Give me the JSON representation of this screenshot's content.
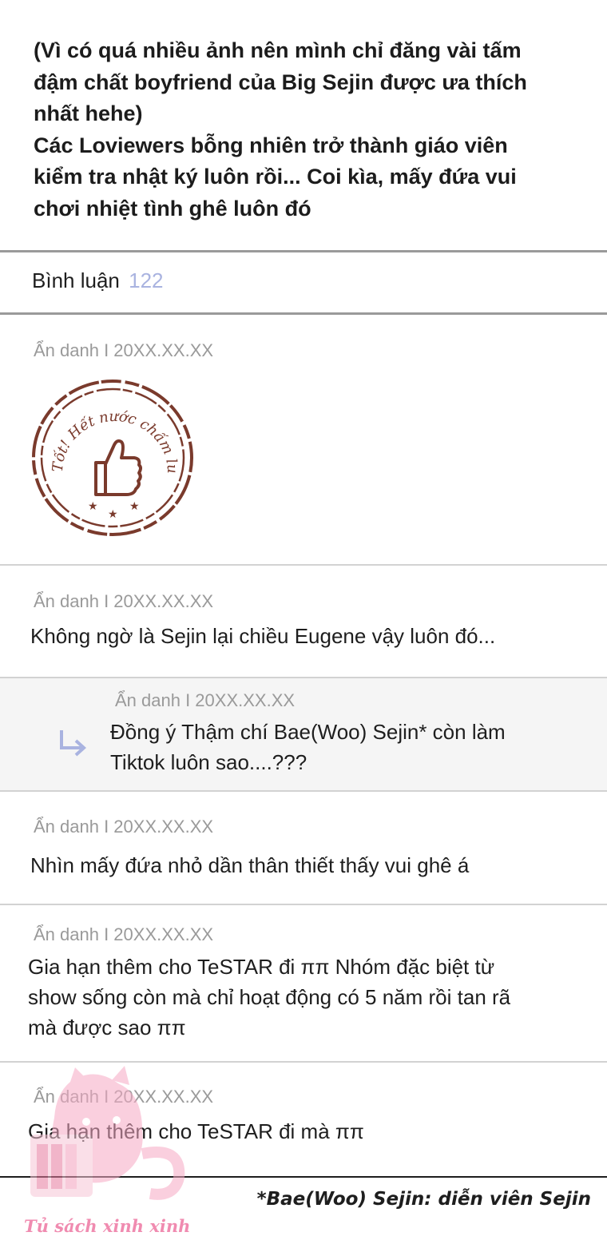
{
  "post": {
    "lines": [
      "(Vì có quá nhiều ảnh nên mình chỉ đăng vài tấm",
      "đậm chất boyfriend của Big Sejin được ưa thích",
      "nhất hehe)",
      "Các Loviewers bỗng nhiên trở thành giáo viên",
      "kiểm tra nhật ký luôn rồi... Coi kìa, mấy đứa vui",
      "chơi nhiệt tình ghê luôn đó"
    ]
  },
  "comments_header": {
    "label": "Bình luận",
    "count": "122"
  },
  "comments": [
    {
      "meta": "Ẩn danh I 20XX.XX.XX",
      "stamp_text": "Tốt! Hết nước chấm luôn"
    },
    {
      "meta": "Ẩn danh I 20XX.XX.XX",
      "text": "Không ngờ là Sejin lại chiều Eugene vậy luôn đó..."
    },
    {
      "meta": "Ẩn danh I 20XX.XX.XX",
      "line1": "Đồng ý Thậm chí Bae(Woo) Sejin* còn làm",
      "line2": "Tiktok luôn sao....???"
    },
    {
      "meta": "Ẩn danh I 20XX.XX.XX",
      "text": "Nhìn mấy đứa nhỏ dần thân thiết thấy vui ghê á"
    },
    {
      "meta": "Ẩn danh I 20XX.XX.XX",
      "line1": "Gia hạn thêm cho TeSTAR đi ππ Nhóm đặc biệt từ",
      "line2": "show sống còn mà chỉ hoạt động có 5 năm rồi tan rã",
      "line3": "mà được sao ππ"
    },
    {
      "meta": "Ẩn danh I 20XX.XX.XX",
      "text": "Gia hạn thêm cho TeSTAR đi mà ππ"
    }
  ],
  "footnote": "*Bae(Woo) Sejin: diễn viên Sejin",
  "watermark": "Tủ sách xinh xinh",
  "colors": {
    "count": "#a9b3e0",
    "meta": "#9a9a9a",
    "reply_bg": "#f5f5f5",
    "stamp": "#7a3a2c",
    "watermark": "#f08bb0"
  }
}
